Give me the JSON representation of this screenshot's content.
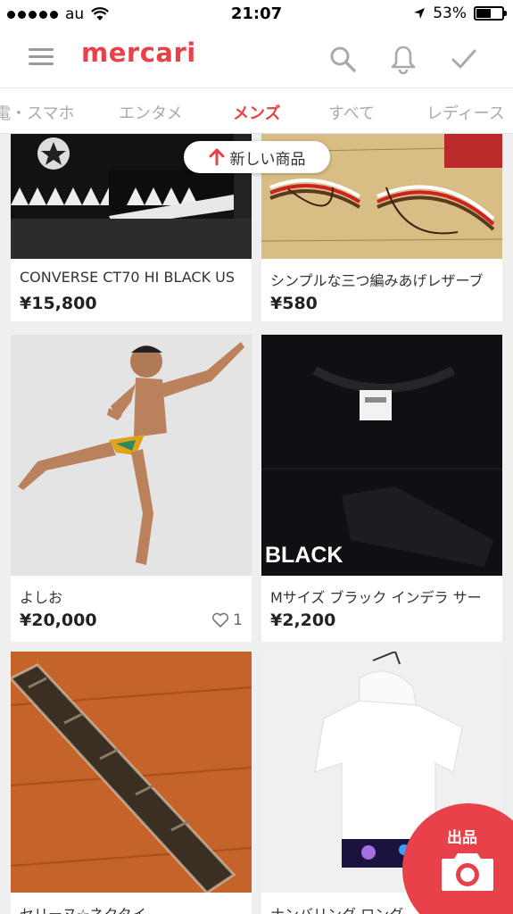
{
  "status_bar": {
    "carrier": "au",
    "time": "21:07",
    "battery": "53%"
  },
  "header": {
    "logo": "mercari"
  },
  "tabs": [
    {
      "label": "電・スマホ"
    },
    {
      "label": "エンタメ"
    },
    {
      "label": "メンズ",
      "active": true
    },
    {
      "label": "すべて"
    },
    {
      "label": "レディース"
    }
  ],
  "new_items_label": "新しい商品",
  "items": [
    {
      "title": "CONVERSE CT70 HI BLACK US",
      "price": "¥15,800",
      "likes": ""
    },
    {
      "title": "シンプルな三つ編みあげレザーブ",
      "price": "¥580",
      "likes": ""
    },
    {
      "title": "よしお",
      "price": "¥20,000",
      "likes": "1"
    },
    {
      "title": "Mサイズ ブラック インデラ サー",
      "price": "¥2,200",
      "likes": "",
      "image_text": "BLACK"
    },
    {
      "title": "セリーヌ☆ネクタイ",
      "price": "",
      "likes": ""
    },
    {
      "title": "ナンバリング ロング",
      "price": "",
      "likes": ""
    }
  ],
  "sell_button": {
    "label": "出品"
  },
  "colors": {
    "brand": "#e8414a",
    "background": "#efefef"
  }
}
